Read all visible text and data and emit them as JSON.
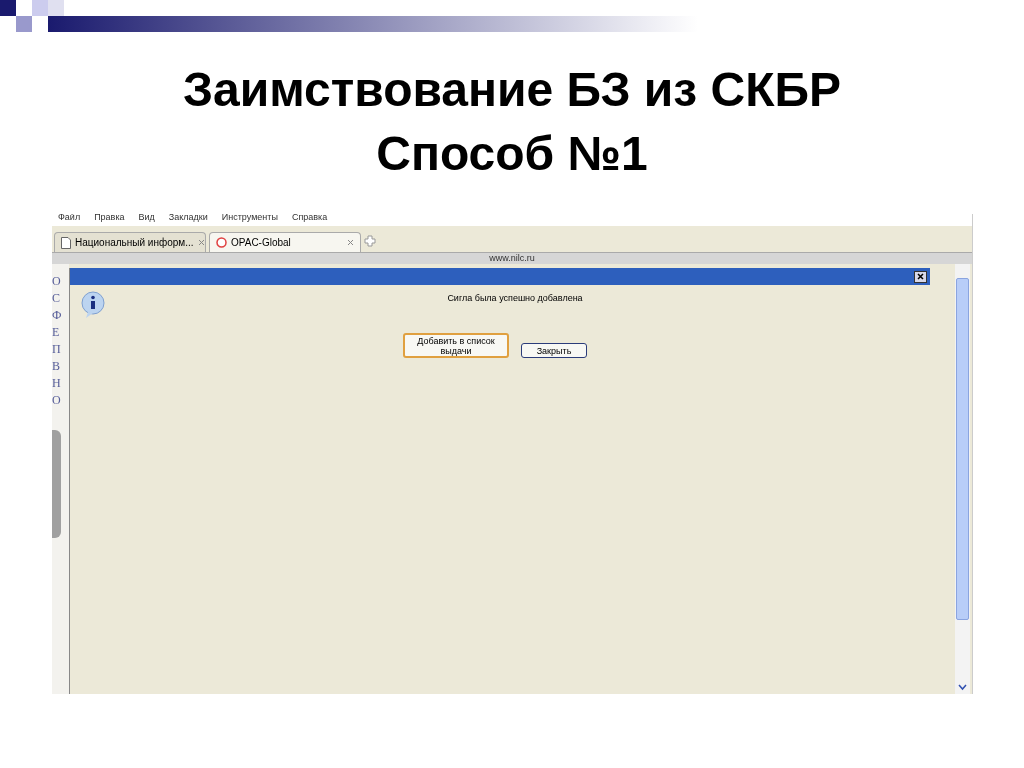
{
  "slide": {
    "title_lines": [
      "Заимствование БЗ из СКБР",
      "Способ №1"
    ]
  },
  "browser": {
    "menu": [
      "Файл",
      "Правка",
      "Вид",
      "Закладки",
      "Инструменты",
      "Справка"
    ],
    "tabs": [
      {
        "label": "Национальный информ...",
        "selected": false,
        "kind": "page"
      },
      {
        "label": "OPAC-Global",
        "selected": true,
        "kind": "opac"
      }
    ],
    "status_url": "www.nilc.ru",
    "page_letters": [
      "О",
      "С",
      "Ф",
      "Е",
      "П",
      "В",
      "Н",
      "О"
    ]
  },
  "dialog": {
    "message": "Сигла была успешно добавлена",
    "buttons": [
      {
        "label": "Добавить в список выдачи",
        "kind": "default"
      },
      {
        "label": "Закрыть",
        "kind": "normal"
      }
    ]
  }
}
